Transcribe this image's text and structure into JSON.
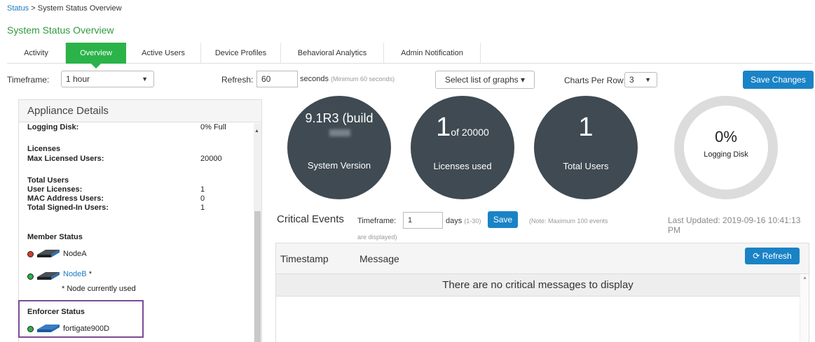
{
  "breadcrumb": {
    "link": "Status",
    "separator": ">",
    "current": "System Status Overview"
  },
  "page_title": "System Status Overview",
  "tabs": [
    {
      "label": "Activity",
      "active": false
    },
    {
      "label": "Overview",
      "active": true
    },
    {
      "label": "Active Users",
      "active": false
    },
    {
      "label": "Device Profiles",
      "active": false
    },
    {
      "label": "Behavioral Analytics",
      "active": false
    },
    {
      "label": "Admin Notification",
      "active": false
    }
  ],
  "toolbar": {
    "timeframe_label": "Timeframe:",
    "timeframe_value": "1 hour",
    "refresh_label": "Refresh:",
    "refresh_value": "60",
    "seconds_label": "seconds",
    "seconds_hint": "(Minimum 60 seconds)",
    "graphs_button": "Select list of graphs ▾",
    "charts_per_row_label": "Charts Per Row:",
    "charts_per_row_value": "3",
    "save_changes": "Save Changes"
  },
  "appliance": {
    "title": "Appliance Details",
    "logging_disk_label": "Logging Disk:",
    "logging_disk_value": "0% Full",
    "licenses_heading": "Licenses",
    "max_licensed_label": "Max Licensed Users:",
    "max_licensed_value": "20000",
    "total_users_heading": "Total Users",
    "user_licenses_label": "User Licenses:",
    "user_licenses_value": "1",
    "mac_users_label": "MAC Address Users:",
    "mac_users_value": "0",
    "signed_in_label": "Total Signed-In Users:",
    "signed_in_value": "1",
    "member_status_heading": "Member Status",
    "node_a": "NodeA",
    "node_b": "NodeB",
    "node_b_mark": "*",
    "node_note": "* Node currently used",
    "enforcer_heading": "Enforcer Status",
    "enforcer_name": "fortigate900D"
  },
  "stats": {
    "system_version_value": "9.1R3 (build",
    "system_version_label": "System Version",
    "licenses_used_big": "1",
    "licenses_used_small": "of 20000",
    "licenses_used_label": "Licenses used",
    "total_users_value": "1",
    "total_users_label": "Total Users",
    "logging_disk_pct": "0%",
    "logging_disk_label": "Logging Disk",
    "logging_disk_fill": 0
  },
  "critical_events": {
    "title": "Critical Events",
    "timeframe_label": "Timeframe:",
    "timeframe_value": "1",
    "days_label": "days",
    "days_range": "(1-30)",
    "save": "Save",
    "note": "(Note: Maximum 100 events",
    "note_cont": "are displayed)",
    "last_updated": "Last Updated: 2019-09-16 10:41:13 PM",
    "col_timestamp": "Timestamp",
    "col_message": "Message",
    "refresh": "Refresh",
    "empty_message": "There are no critical messages to display"
  },
  "colors": {
    "green_accent": "#2bb34a",
    "title_green": "#2e9b3e",
    "primary_blue": "#1a83c6",
    "circle_dark": "#3f4a52",
    "enforcer_highlight": "#7b4b98",
    "led_red": "#d43c2c",
    "led_green": "#28b24a"
  }
}
